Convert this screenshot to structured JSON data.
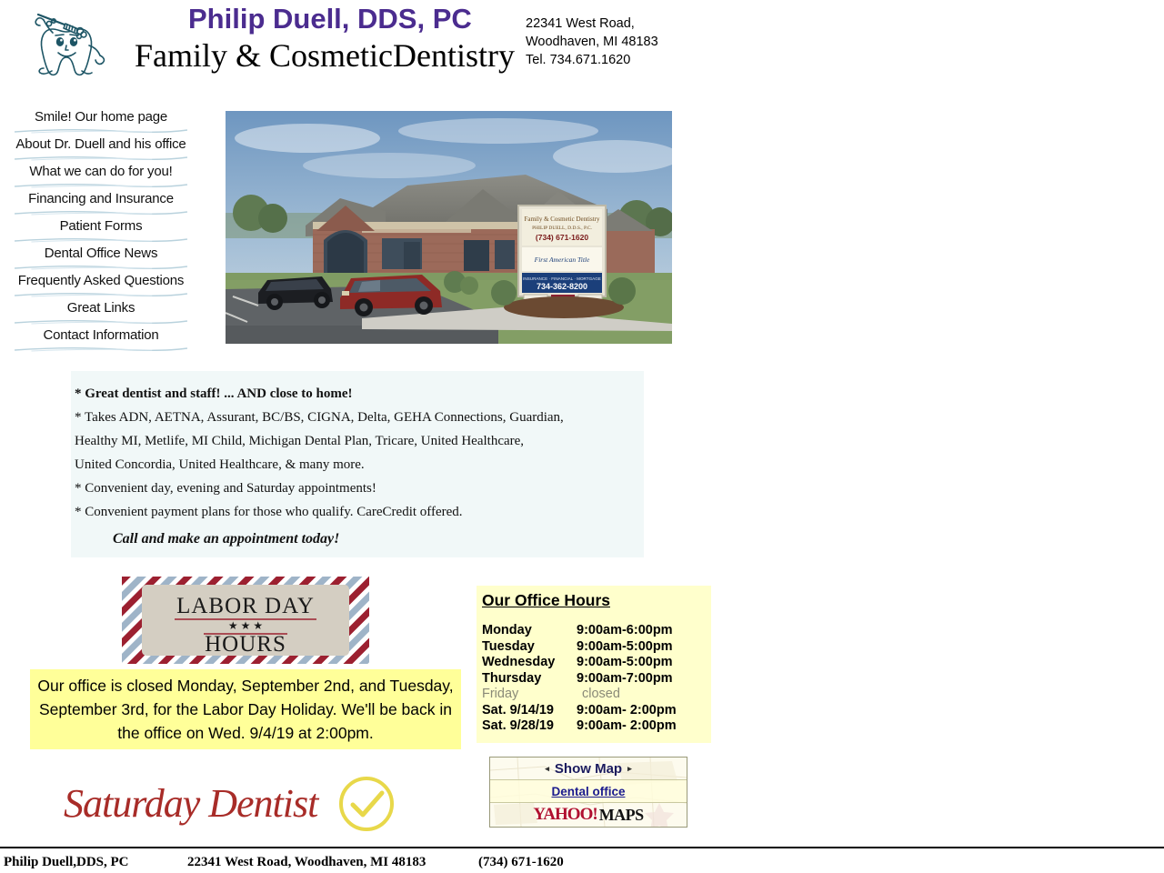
{
  "header": {
    "practice_name": "Philip Duell, DDS, PC",
    "tagline": "Family & CosmeticDentistry",
    "address_line1": "22341 West Road,",
    "address_line2": "Woodhaven, MI 48183",
    "address_line3": "Tel. 734.671.1620",
    "logo_icon": "tooth-mascot-icon",
    "name_color": "#4b2c8f"
  },
  "nav": {
    "items": [
      {
        "label": "Smile! Our home page"
      },
      {
        "label": "About Dr. Duell and his office"
      },
      {
        "label": "What we can do for you!"
      },
      {
        "label": "Financing and Insurance"
      },
      {
        "label": "Patient Forms"
      },
      {
        "label": "Dental Office News"
      },
      {
        "label": "Frequently Asked Questions"
      },
      {
        "label": "Great Links"
      },
      {
        "label": "Contact Information"
      }
    ]
  },
  "photo": {
    "alt": "Exterior photo of the dental office building with parking lot and street sign"
  },
  "info_box": {
    "background": "#f1f8f8",
    "lines": [
      {
        "text": "*  Great dentist and staff! ... AND close to home!",
        "style": "bold"
      },
      {
        "text": "*  Takes ADN, AETNA, Assurant, BC/BS, CIGNA, Delta, GEHA Connections, Guardian,",
        "style": "normal"
      },
      {
        "text": "Healthy MI, Metlife, MI Child, Michigan Dental Plan, Tricare, United Healthcare,",
        "style": "normal"
      },
      {
        "text": "United Concordia, United Healthcare, & many more.",
        "style": "normal"
      },
      {
        "text": "*  Convenient day, evening and Saturday appointments!",
        "style": "normal"
      },
      {
        "text": "*  Convenient payment plans for those who qualify. CareCredit offered.",
        "style": "normal"
      }
    ],
    "callout": "Call and make an appointment today!"
  },
  "labor_banner": {
    "line1": "LABOR  DAY",
    "line2": "HOURS",
    "stars": "★ ★ ★",
    "panel_color": "#d4cec2",
    "stripe_red": "#9c2030",
    "stripe_blue": "#9fb4c8"
  },
  "closure_notice": {
    "background": "#ffff99",
    "text": "Our office is closed Monday, September 2nd, and Tuesday, September 3rd, for the Labor Day Holiday.  We'll be back in the office on Wed. 9/4/19 at 2:00pm."
  },
  "office_hours": {
    "title": "Our Office Hours",
    "background": "#ffffcc",
    "rows": [
      {
        "day": "Monday",
        "time": "9:00am-6:00pm",
        "closed": false
      },
      {
        "day": "Tuesday",
        "time": "9:00am-5:00pm",
        "closed": false
      },
      {
        "day": "Wednesday",
        "time": "9:00am-5:00pm",
        "closed": false
      },
      {
        "day": "Thursday",
        "time": "9:00am-7:00pm",
        "closed": false
      },
      {
        "day": "Friday",
        "time": "closed",
        "closed": true
      },
      {
        "day": "Sat. 9/14/19",
        "time": "9:00am- 2:00pm",
        "closed": false
      },
      {
        "day": "Sat. 9/28/19",
        "time": "9:00am- 2:00pm",
        "closed": false
      }
    ]
  },
  "saturday_logo": {
    "text": "Saturday Dentist",
    "icon": "check-circle-icon",
    "text_color": "#a82c28",
    "icon_color": "#e8d84a"
  },
  "map_widget": {
    "show_map_label": "Show Map",
    "left_arrow": "◂",
    "right_arrow": "▸",
    "office_link": "Dental office",
    "brand_yahoo": "YAHOO!",
    "brand_maps": "MAPS"
  },
  "footer": {
    "name": "Philip  Duell,DDS, PC",
    "address": "22341 West Road, Woodhaven, MI 48183",
    "phone": "(734) 671-1620"
  }
}
